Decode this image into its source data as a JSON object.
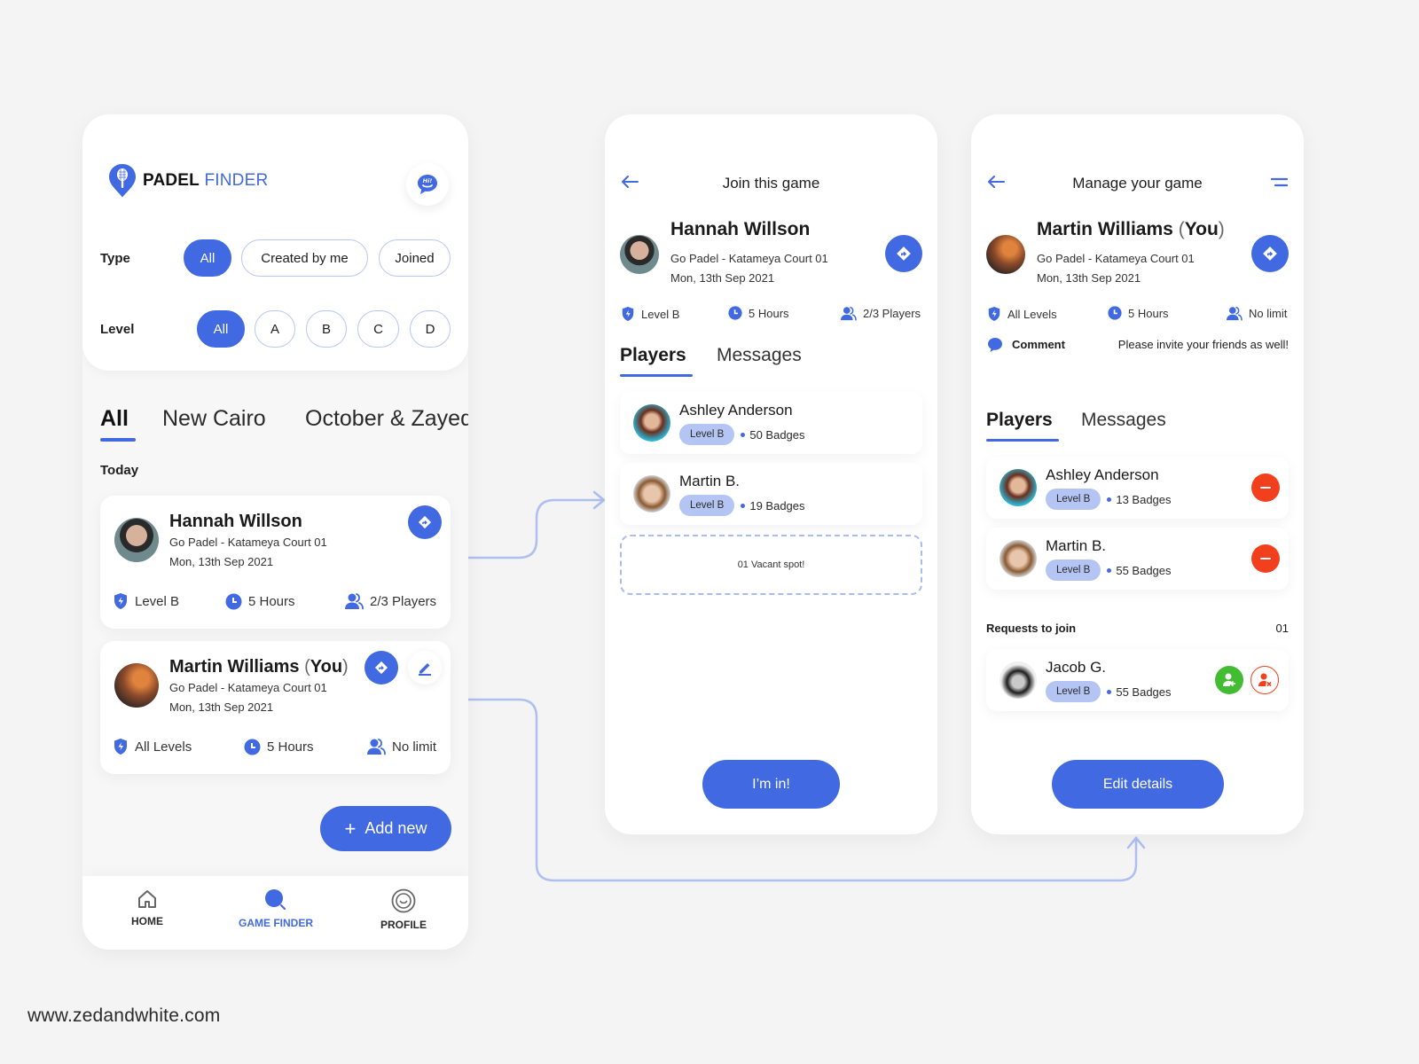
{
  "colors": {
    "accent": "#4169e1",
    "accent_light": "#b4c5f3",
    "danger": "#f2401f",
    "success": "#43bb32",
    "background": "#f4f4f4"
  },
  "footer": {
    "url": "www.zedandwhite.com"
  },
  "game_finder": {
    "logo": {
      "bold": "PADEL",
      "light": "FINDER",
      "icon": "padel-pin-icon"
    },
    "hi_button": {
      "icon": "hi-chat-icon",
      "text": "Hi!"
    },
    "filters": {
      "type": {
        "label": "Type",
        "options": [
          "All",
          "Created by me",
          "Joined"
        ],
        "selected": "All"
      },
      "level": {
        "label": "Level",
        "options": [
          "All",
          "A",
          "B",
          "C",
          "D"
        ],
        "selected": "All"
      }
    },
    "area_tabs": [
      {
        "label": "All",
        "active": true
      },
      {
        "label": "New Cairo",
        "active": false
      },
      {
        "label": "October & Zayed",
        "active": false
      }
    ],
    "section_label": "Today",
    "games": [
      {
        "host": "Hannah Willson",
        "host_suffix": "",
        "venue": "Go Padel - Katameya Court 01",
        "date": "Mon, 13th Sep 2021",
        "level": "Level B",
        "duration": "5 Hours",
        "players": "2/3 Players",
        "editable": false
      },
      {
        "host": "Martin Williams",
        "host_suffix": "You",
        "venue": "Go Padel - Katameya Court 01",
        "date": "Mon, 13th Sep 2021",
        "level": "All Levels",
        "duration": "5 Hours",
        "players": "No limit",
        "editable": true
      }
    ],
    "add_button": {
      "label": "Add new",
      "icon": "plus-icon"
    },
    "bottom_nav": [
      {
        "label": "HOME",
        "icon": "home-icon",
        "active": false
      },
      {
        "label": "GAME FINDER",
        "icon": "search-icon",
        "active": true
      },
      {
        "label": "PROFILE",
        "icon": "smiley-icon",
        "active": false
      }
    ]
  },
  "join_game": {
    "title": "Join this game",
    "host": "Hannah Willson",
    "venue": "Go Padel - Katameya Court 01",
    "date": "Mon, 13th Sep 2021",
    "level": "Level B",
    "duration": "5 Hours",
    "players": "2/3 Players",
    "tabs": [
      {
        "label": "Players",
        "active": true
      },
      {
        "label": "Messages",
        "active": false
      }
    ],
    "player_list": [
      {
        "name": "Ashley Anderson",
        "level": "Level B",
        "badges": "50 Badges"
      },
      {
        "name": "Martin B.",
        "level": "Level B",
        "badges": "19 Badges"
      }
    ],
    "vacant": "01 Vacant spot!",
    "cta": "I’m in!"
  },
  "manage_game": {
    "title": "Manage your game",
    "host": "Martin Williams",
    "host_suffix": "You",
    "venue": "Go Padel - Katameya Court 01",
    "date": "Mon, 13th Sep 2021",
    "level": "All Levels",
    "duration": "5 Hours",
    "players": "No limit",
    "comment_label": "Comment",
    "comment": "Please invite your friends as well!",
    "tabs": [
      {
        "label": "Players",
        "active": true
      },
      {
        "label": "Messages",
        "active": false
      }
    ],
    "player_list": [
      {
        "name": "Ashley Anderson",
        "level": "Level B",
        "badges": "13 Badges"
      },
      {
        "name": "Martin B.",
        "level": "Level B",
        "badges": "55 Badges"
      }
    ],
    "requests_label": "Requests to join",
    "requests_count": "01",
    "requests": [
      {
        "name": "Jacob G.",
        "level": "Level B",
        "badges": "55 Badges"
      }
    ],
    "cta": "Edit details"
  }
}
